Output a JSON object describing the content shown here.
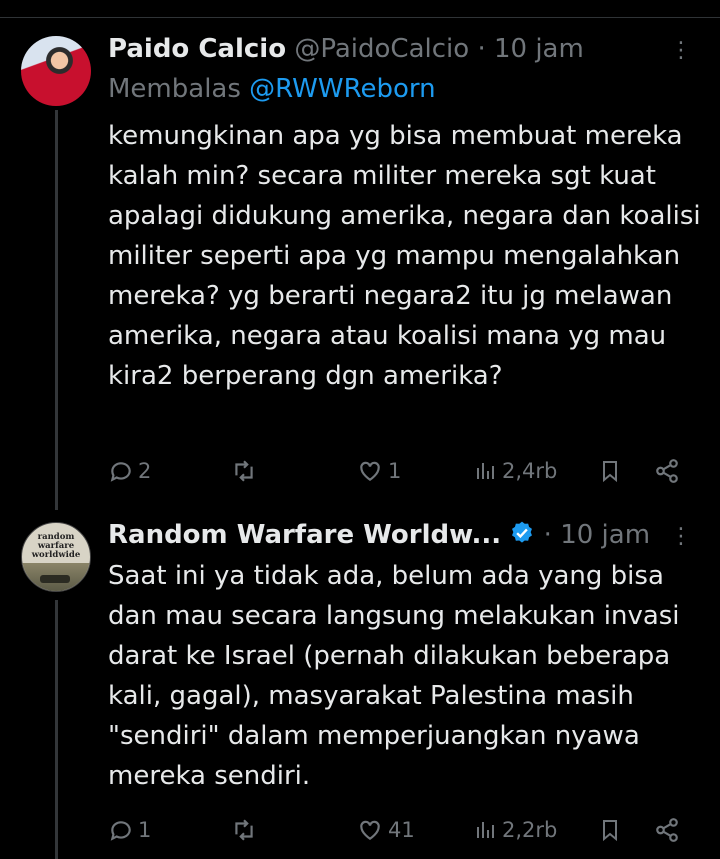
{
  "tweets": [
    {
      "name": "Paido Calcio",
      "handle": "@PaidoCalcio",
      "sep": "·",
      "time": "10 jam",
      "reply_prefix": "Membalas",
      "reply_to": "@RWWReborn",
      "text": "kemungkinan apa yg bisa membuat mereka kalah min? secara militer mereka sgt kuat apalagi didukung amerika, negara dan koalisi militer seperti apa yg mampu mengalahkan mereka? yg berarti negara2 itu jg melawan amerika, negara atau koalisi mana yg mau kira2 berperang dgn amerika?",
      "replies": "2",
      "retweets": "",
      "likes": "1",
      "views": "2,4rb"
    },
    {
      "name": "Random Warfare Worldw...",
      "verified": true,
      "sep": "·",
      "time": "10 jam",
      "avatar_text": "random warfare worldwide",
      "text": "Saat ini ya tidak ada, belum ada yang bisa dan mau secara langsung melakukan invasi darat ke Israel (pernah dilakukan beberapa kali, gagal), masyarakat Palestina masih \"sendiri\" dalam memperjuangkan nyawa mereka sendiri.",
      "replies": "1",
      "retweets": "",
      "likes": "41",
      "views": "2,2rb"
    }
  ],
  "colors": {
    "background": "#000000",
    "text": "#e7e9ea",
    "muted": "#71767b",
    "link": "#1d9bf0",
    "verified": "#1d9bf0"
  },
  "icons": [
    "more-icon",
    "reply-icon",
    "retweet-icon",
    "like-icon",
    "views-icon",
    "bookmark-icon",
    "share-icon",
    "verified-icon"
  ]
}
